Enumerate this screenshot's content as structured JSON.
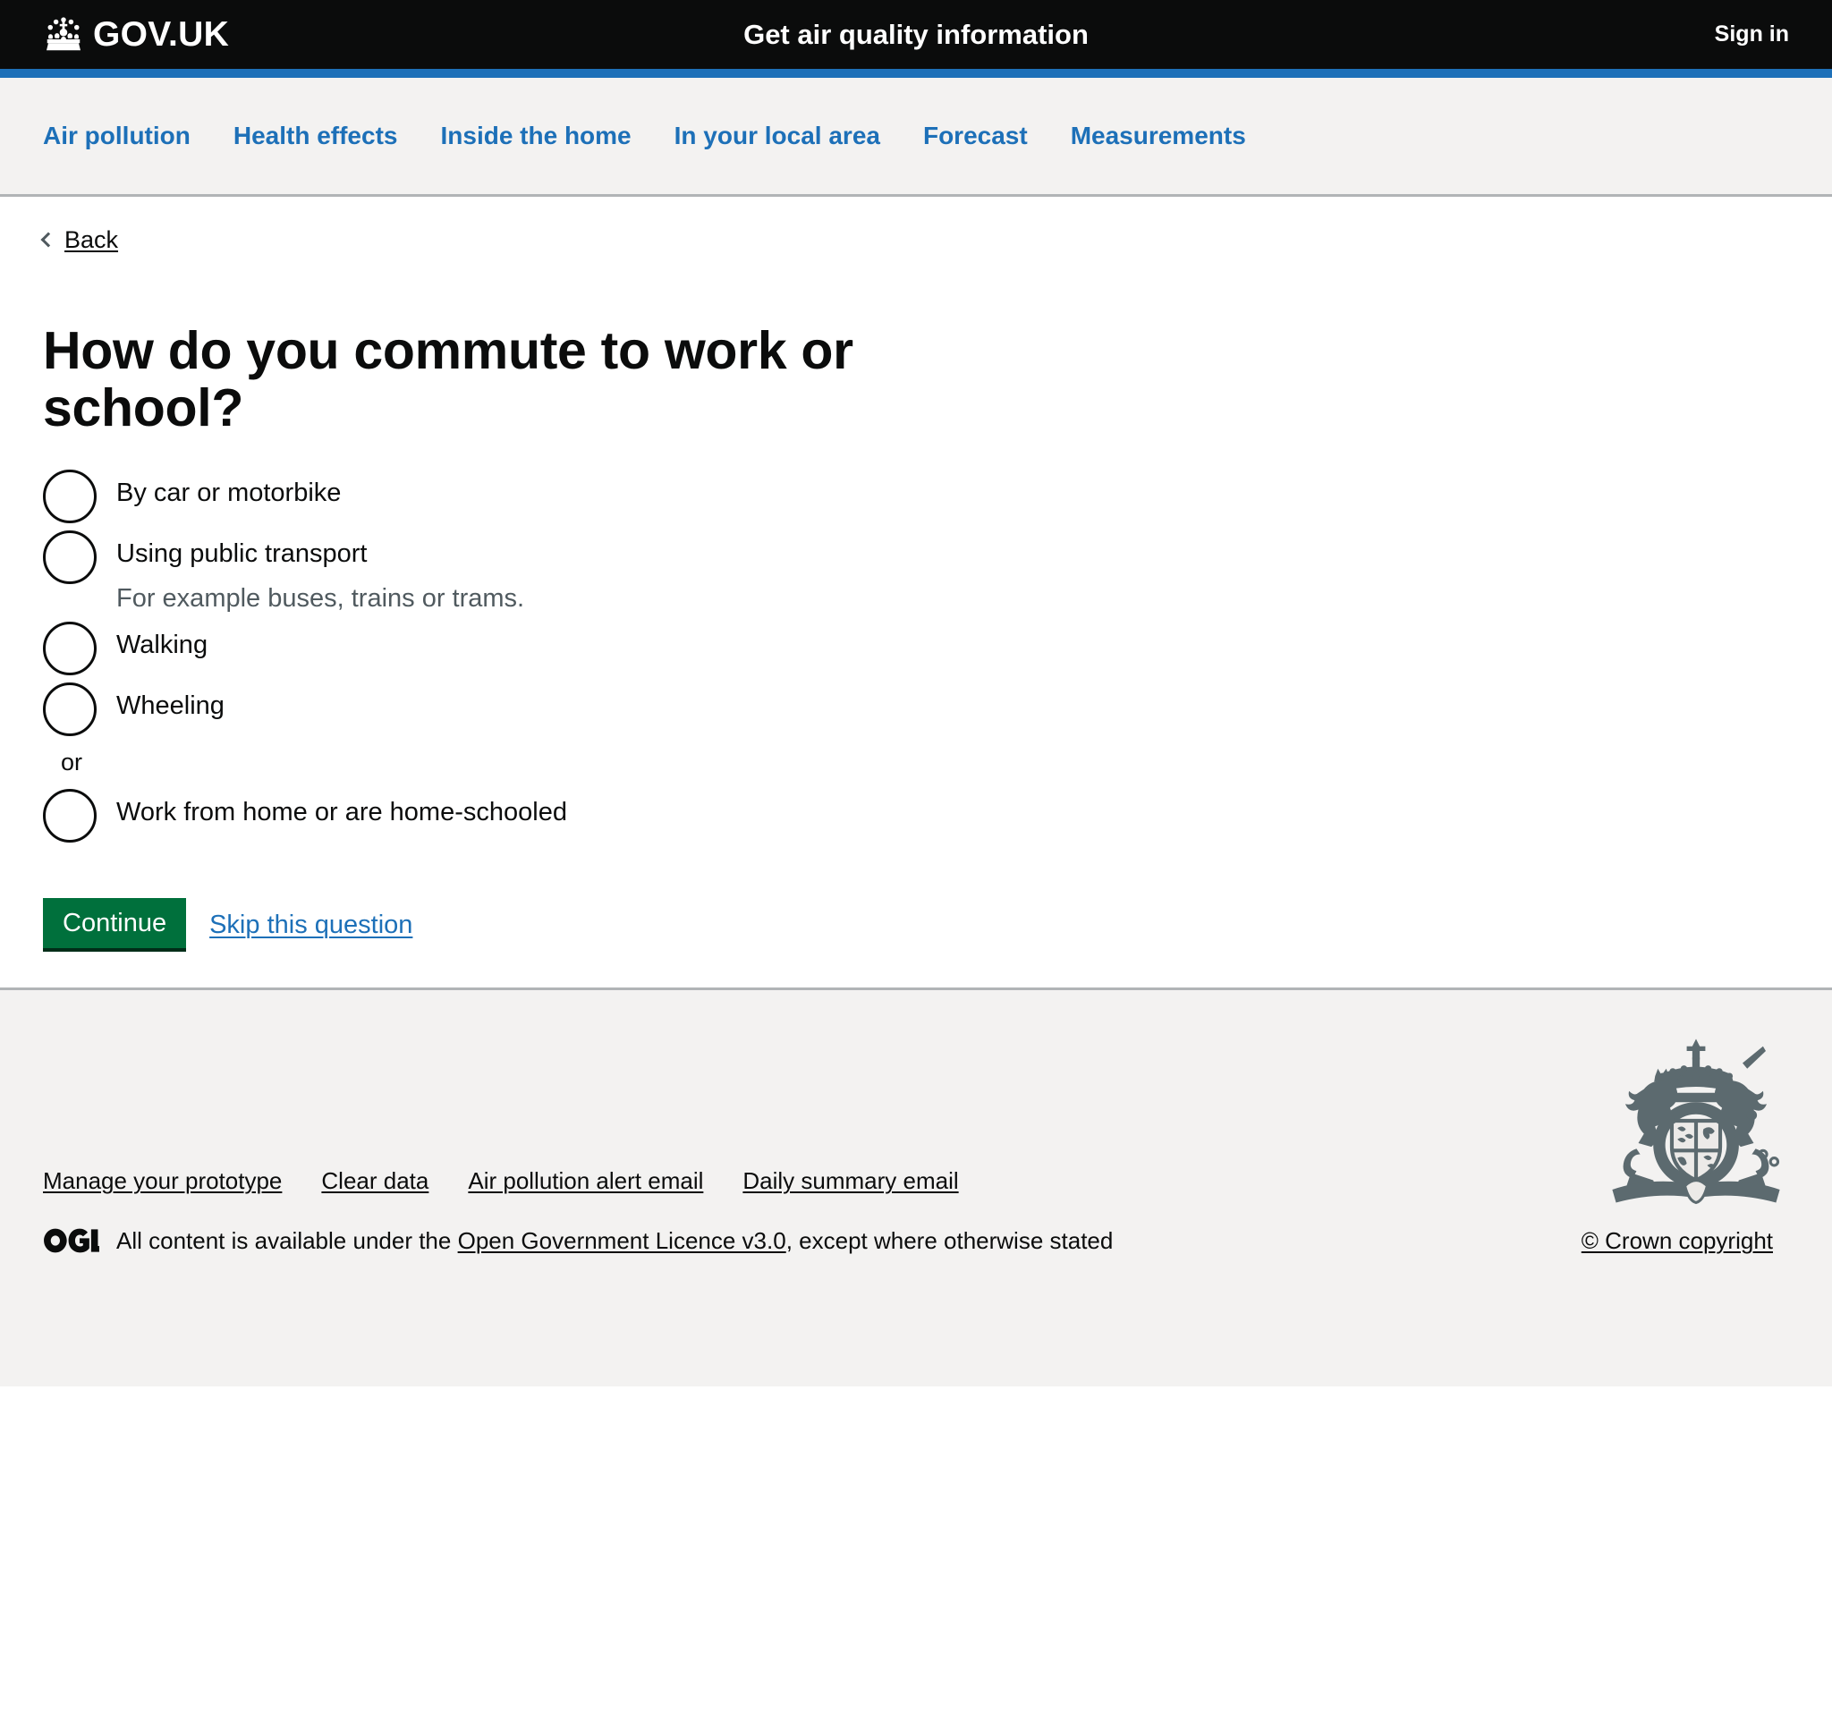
{
  "header": {
    "brand": "GOV.UK",
    "crown_icon": "govuk-crown-icon",
    "service_name": "Get air quality information",
    "sign_in": "Sign in",
    "background": "#0b0c0c",
    "accent": "#1d70b8"
  },
  "service_nav": {
    "items": [
      {
        "label": "Air pollution"
      },
      {
        "label": "Health effects"
      },
      {
        "label": "Inside the home"
      },
      {
        "label": "In your local area"
      },
      {
        "label": "Forecast"
      },
      {
        "label": "Measurements"
      }
    ],
    "link_color": "#1d70b8",
    "background": "#f3f2f1"
  },
  "back": {
    "label": "Back",
    "icon": "chevron-left-icon"
  },
  "main": {
    "heading": "How do you commute to work or school?",
    "radios": [
      {
        "label": "By car or motorbike",
        "hint": null,
        "checked": false
      },
      {
        "label": "Using public transport",
        "hint": "For example buses, trains or trams.",
        "checked": false
      },
      {
        "label": "Walking",
        "hint": null,
        "checked": false
      },
      {
        "label": "Wheeling",
        "hint": null,
        "checked": false
      },
      {
        "label": "Work from home or are home-schooled",
        "hint": null,
        "checked": false
      }
    ],
    "divider_label": "or",
    "divider_after_index": 3,
    "continue_label": "Continue",
    "skip_label": "Skip this question",
    "button_color": "#00703c"
  },
  "footer": {
    "arms_icon": "royal-coat-of-arms-icon",
    "links": [
      {
        "label": "Manage your prototype"
      },
      {
        "label": "Clear data"
      },
      {
        "label": "Air pollution alert email"
      },
      {
        "label": "Daily summary email"
      }
    ],
    "ogl_icon": "ogl-logo-icon",
    "licence_prefix": "All content is available under the",
    "licence_link": "Open Government Licence v3.0",
    "licence_suffix": ", except where otherwise stated",
    "crown_copyright": "© Crown copyright",
    "background": "#f3f2f1",
    "border": "#b1b4b6"
  }
}
